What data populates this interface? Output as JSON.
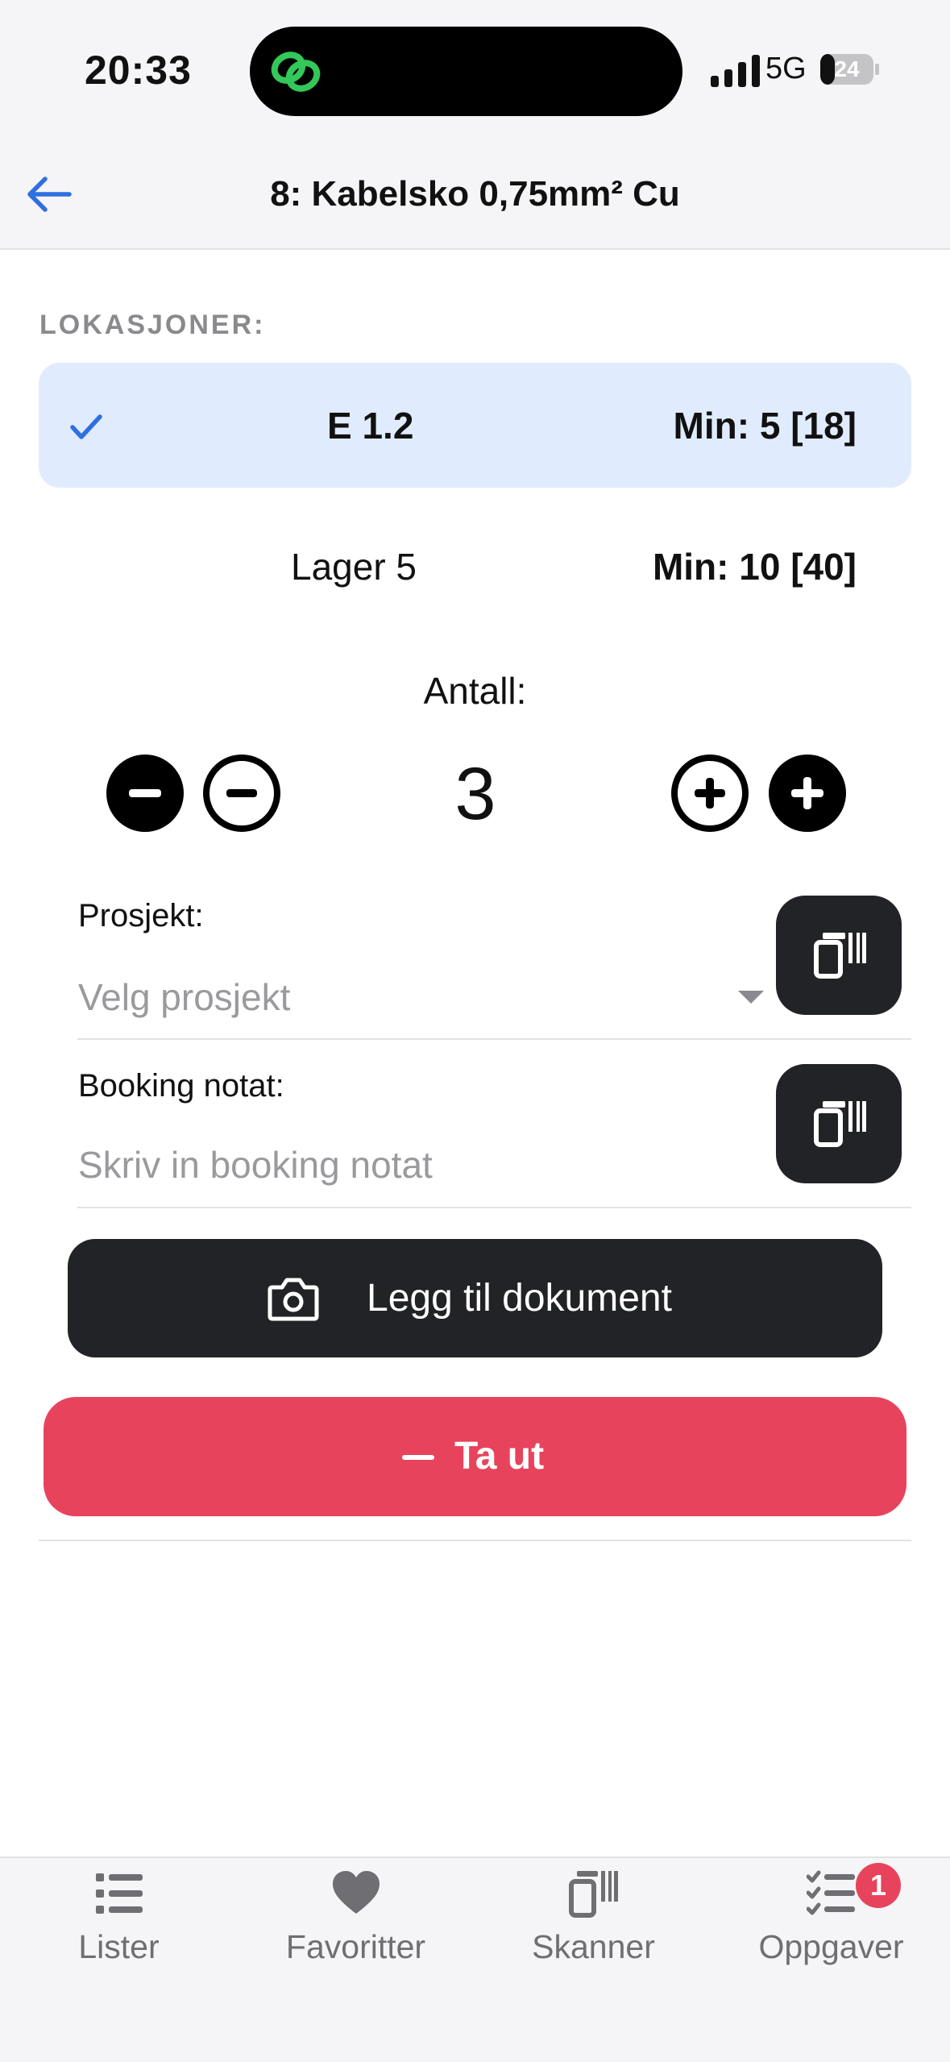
{
  "status_bar": {
    "time": "20:33",
    "network": "5G",
    "battery": "24"
  },
  "header": {
    "title": "8: Kabelsko 0,75mm² Cu"
  },
  "locations": {
    "section_label": "LOKASJONER:",
    "items": [
      {
        "name": "E 1.2",
        "min": "Min: 5 [18]",
        "selected": true
      },
      {
        "name": "Lager 5",
        "min": "Min: 10 [40]",
        "selected": false
      }
    ]
  },
  "quantity": {
    "label": "Antall:",
    "value": "3"
  },
  "project": {
    "label": "Prosjekt:",
    "placeholder": "Velg prosjekt"
  },
  "booking_note": {
    "label": "Booking notat:",
    "placeholder": "Skriv in booking notat"
  },
  "actions": {
    "add_document": "Legg til dokument",
    "take_out": "Ta ut"
  },
  "tabbar": {
    "tabs": [
      {
        "label": "Lister",
        "icon": "list-icon"
      },
      {
        "label": "Favoritter",
        "icon": "heart-icon"
      },
      {
        "label": "Skanner",
        "icon": "scanner-icon"
      },
      {
        "label": "Oppgaver",
        "icon": "checklist-icon",
        "badge": "1"
      }
    ]
  },
  "colors": {
    "accent_blue": "#2f6fe0",
    "selected_row": "#e0ecfe",
    "danger": "#e8435c",
    "dark_button": "#222326"
  }
}
